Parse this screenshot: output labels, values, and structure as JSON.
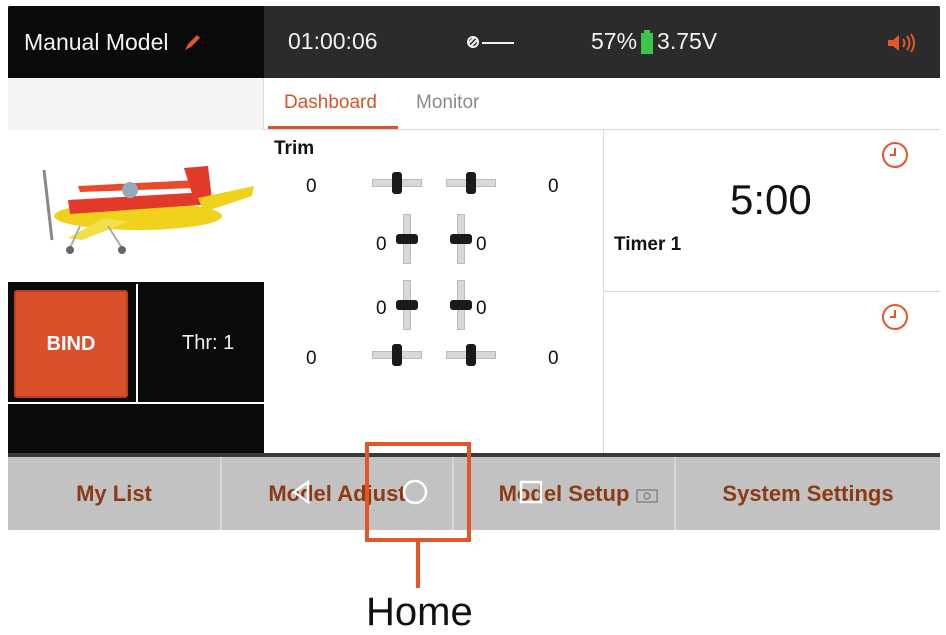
{
  "status_bar": {
    "model_name": "Manual Model",
    "time": "01:00:06",
    "battery_percent": "57%",
    "voltage": "3.75V",
    "icons": [
      "pencil-icon",
      "link-icon",
      "battery-icon",
      "speaker-icon"
    ]
  },
  "tabs": [
    {
      "label": "Dashboard",
      "active": true
    },
    {
      "label": "Monitor",
      "active": false
    }
  ],
  "left_panel": {
    "bind_label": "BIND",
    "throttle_label": "Thr: 1"
  },
  "trim": {
    "title": "Trim",
    "values": {
      "top_left": "0",
      "top_right": "0",
      "mid_upper_left": "0",
      "mid_upper_right": "0",
      "mid_lower_left": "0",
      "mid_lower_right": "0",
      "bottom_left": "0",
      "bottom_right": "0"
    }
  },
  "timer": {
    "value": "5:00",
    "label": "Timer 1"
  },
  "bottom_nav": {
    "items": [
      "My List",
      "Model Adjust",
      "Model Setup",
      "System Settings"
    ],
    "system_buttons": [
      "back-icon",
      "home-icon",
      "recents-icon"
    ]
  },
  "callout": {
    "label": "Home"
  },
  "colors": {
    "accent": "#d5542a",
    "bind": "#d9502a",
    "nav_text": "#8b3a14",
    "battery": "#3cc54a"
  }
}
